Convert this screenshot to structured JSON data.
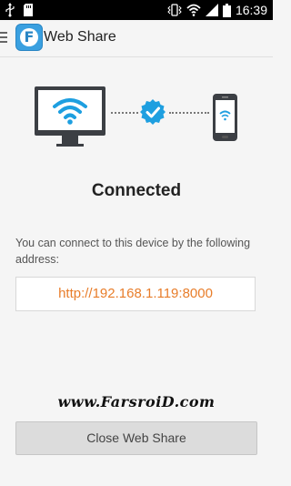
{
  "status_bar": {
    "time": "16:39",
    "left_icons": [
      "usb-icon",
      "sd-card-icon"
    ],
    "right_icons": [
      "vibrate-icon",
      "wifi-signal-icon",
      "cell-signal-icon",
      "battery-icon"
    ]
  },
  "action_bar": {
    "title": "Web Share",
    "logo_letter": "F"
  },
  "main": {
    "status": "Connected",
    "description": "You can connect to this device by the following address:",
    "address": "http://192.168.1.119:8000",
    "watermark": "www.FarsroiD.com",
    "close_button": "Close Web Share"
  },
  "colors": {
    "accent": "#e87d2a",
    "wifi_blue": "#1e9fe0",
    "check_blue": "#1e9fe0",
    "device_dark": "#3c3f44"
  }
}
